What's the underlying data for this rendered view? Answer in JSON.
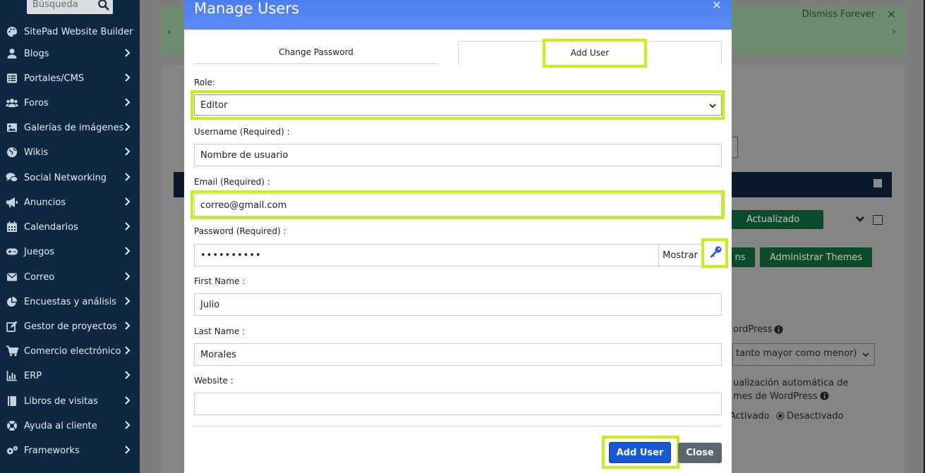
{
  "sidebar": {
    "search_placeholder": "Búsqueda",
    "items": [
      {
        "label": "SitePad Website Builder",
        "icon": "palette-icon",
        "has_chevron": false
      },
      {
        "label": "Blogs",
        "icon": "user-icon",
        "has_chevron": true
      },
      {
        "label": "Portales/CMS",
        "icon": "list-icon",
        "has_chevron": true
      },
      {
        "label": "Foros",
        "icon": "users-icon",
        "has_chevron": true
      },
      {
        "label": "Galerías de imágenes",
        "icon": "image-icon",
        "has_chevron": true
      },
      {
        "label": "Wikis",
        "icon": "globe-icon",
        "has_chevron": true
      },
      {
        "label": "Social Networking",
        "icon": "comments-icon",
        "has_chevron": true
      },
      {
        "label": "Anuncios",
        "icon": "megaphone-icon",
        "has_chevron": true
      },
      {
        "label": "Calendarios",
        "icon": "calendar-icon",
        "has_chevron": true
      },
      {
        "label": "Juegos",
        "icon": "gamepad-icon",
        "has_chevron": true
      },
      {
        "label": "Correo",
        "icon": "envelope-icon",
        "has_chevron": true
      },
      {
        "label": "Encuestas y análisis",
        "icon": "pie-chart-icon",
        "has_chevron": true
      },
      {
        "label": "Gestor de proyectos",
        "icon": "edit-icon",
        "has_chevron": true
      },
      {
        "label": "Comercio electrónico",
        "icon": "cart-icon",
        "has_chevron": true
      },
      {
        "label": "ERP",
        "icon": "bar-chart-icon",
        "has_chevron": true
      },
      {
        "label": "Libros de visitas",
        "icon": "book-icon",
        "has_chevron": true
      },
      {
        "label": "Ayuda al cliente",
        "icon": "lifebuoy-icon",
        "has_chevron": true
      },
      {
        "label": "Frameworks",
        "icon": "cogs-icon",
        "has_chevron": true
      }
    ]
  },
  "background": {
    "dismiss": "Dismiss Forever",
    "btn_actualizado": "Actualizado",
    "btn_ns": "ns",
    "btn_admin_themes": "Administrar Themes",
    "text_wordpress": "ordPress",
    "select_text": "tanto mayor como menor)",
    "auto_update_line1": "ualización automática de",
    "auto_update_line2": "mes de WordPress",
    "radio_activado": "Activado",
    "radio_desactivado": "Desactivado"
  },
  "modal": {
    "title": "Manage Users",
    "tabs": {
      "change_password": "Change Password",
      "add_user": "Add User"
    },
    "fields": {
      "role_label": "Role:",
      "role_value": "Editor",
      "username_label": "Username (Required) :",
      "username_value": "Nombre de usuario",
      "email_label": "Email (Required) :",
      "email_value": "correo@gmail.com",
      "password_label": "Password (Required) :",
      "password_value": "••••••••••",
      "show_label": "Mostrar",
      "first_name_label": "First Name :",
      "first_name_value": "Julio",
      "last_name_label": "Last Name :",
      "last_name_value": "Morales",
      "website_label": "Website :",
      "website_value": ""
    },
    "buttons": {
      "add_user": "Add User",
      "close": "Close"
    }
  },
  "colors": {
    "sidebar_bg": "#0f2741",
    "modal_header": "#5b8cf6",
    "highlight": "#c5f01c",
    "primary_button": "#1558d8",
    "close_button": "#5b6673"
  }
}
